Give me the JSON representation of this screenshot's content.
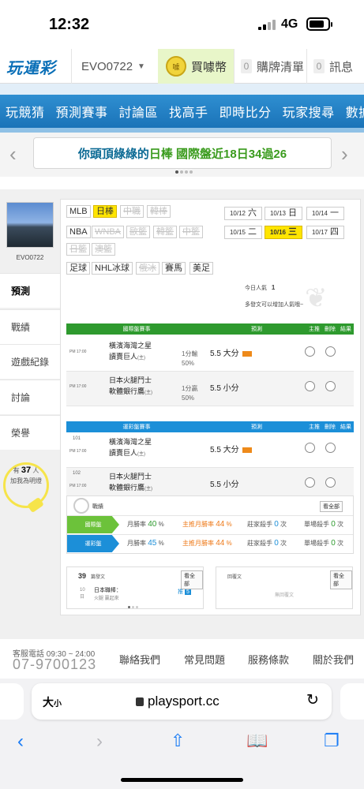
{
  "status_bar": {
    "time": "12:32",
    "network": "4G"
  },
  "nav": {
    "logo": "玩運彩",
    "username": "EVO0722",
    "buy_coin": "買噱幣",
    "coin_icon_text": "噱",
    "cart_count": "0",
    "cart_label": "購牌清單",
    "msg_count": "0",
    "msg_label": "訊息"
  },
  "main_menu": [
    "玩競猜",
    "預測賽事",
    "討論區",
    "找高手",
    "即時比分",
    "玩家搜尋",
    "數據"
  ],
  "marquee": {
    "prefix": "你頭頂綠綠的 ",
    "highlight": "日棒 國際盤近18日34過26"
  },
  "profile": {
    "name": "EVO0722"
  },
  "side_tabs": [
    "預測",
    "戰績",
    "遊戲紀錄",
    "討論",
    "榮譽"
  ],
  "recommend": {
    "prefix": "有",
    "count": "37",
    "unit": "人",
    "line2": "加我為明燈"
  },
  "leagues": [
    {
      "label": "MLB",
      "state": "normal"
    },
    {
      "label": "日棒",
      "state": "selected"
    },
    {
      "label": "中職",
      "state": "disabled"
    },
    {
      "label": "韓棒",
      "state": "disabled"
    },
    {
      "label": "NBA",
      "state": "normal"
    },
    {
      "label": "WNBA",
      "state": "disabled"
    },
    {
      "label": "歐籃",
      "state": "disabled"
    },
    {
      "label": "韓籃",
      "state": "disabled"
    },
    {
      "label": "中籃",
      "state": "disabled"
    },
    {
      "label": "日籃",
      "state": "disabled"
    },
    {
      "label": "澳籃",
      "state": "disabled"
    },
    {
      "label": "足球",
      "state": "normal"
    },
    {
      "label": "NHL冰球",
      "state": "normal"
    },
    {
      "label": "俄冰",
      "state": "disabled"
    },
    {
      "label": "賽馬",
      "state": "normal"
    },
    {
      "label": "美足",
      "state": "normal"
    }
  ],
  "dates": [
    {
      "md": "10/12",
      "wd": "六",
      "state": "normal"
    },
    {
      "md": "10/13",
      "wd": "日",
      "state": "normal"
    },
    {
      "md": "10/14",
      "wd": "一",
      "state": "normal"
    },
    {
      "md": "10/15",
      "wd": "二",
      "state": "normal"
    },
    {
      "md": "10/16",
      "wd": "三",
      "state": "selected"
    },
    {
      "md": "10/17",
      "wd": "四",
      "state": "normal"
    }
  ],
  "popularity": {
    "label": "今日人氣",
    "value": "1"
  },
  "tip": "多發文可以增加人氣哦~",
  "intl": {
    "headers": [
      "國際盤賽事",
      "預測",
      "主推",
      "刪除",
      "結果"
    ],
    "games": [
      {
        "time": "PM 17:00",
        "team1": "橫濱海灣之星",
        "team2": "讀賣巨人",
        "home_tag": "(主)",
        "line": "1分輸",
        "pct": "50%",
        "pick": "5.5 大分",
        "badge": true
      },
      {
        "time": "PM 17:00",
        "team1": "日本火腿鬥士",
        "team2": "軟體銀行鷹",
        "home_tag": "(主)",
        "line": "1分贏",
        "pct": "50%",
        "pick": "5.5 小分",
        "badge": false
      }
    ]
  },
  "lottery": {
    "headers": [
      "運彩盤賽事",
      "預測",
      "主推",
      "刪除",
      "結果"
    ],
    "games": [
      {
        "no": "101",
        "time": "PM 17:00",
        "team1": "橫濱海灣之星",
        "team2": "讀賣巨人",
        "home_tag": "(主)",
        "pick": "5.5 大分",
        "badge": true
      },
      {
        "no": "102",
        "time": "PM 17:00",
        "team1": "日本火腿鬥士",
        "team2": "軟體銀行鷹",
        "home_tag": "(主)",
        "pick": "5.5 小分",
        "badge": false
      }
    ]
  },
  "stats": {
    "title": "戰績",
    "see_all": "看全部",
    "rows": [
      {
        "label": "國際盤",
        "win_label": "月勝率",
        "win": "40",
        "main_label": "主推月勝率",
        "main": "44",
        "streak_label": "莊家殺手",
        "streak": "0",
        "unit": "次",
        "single_label": "單場殺手",
        "single": "0"
      },
      {
        "label": "運彩盤",
        "win_label": "月勝率",
        "win": "45",
        "main_label": "主推月勝率",
        "main": "44",
        "streak_label": "莊家殺手",
        "streak": "0",
        "unit": "次",
        "single_label": "單場殺手",
        "single": "0"
      }
    ]
  },
  "posts": {
    "count": "39",
    "label": "篇發文",
    "see_all": "看全部",
    "article_title": "日本職棒：",
    "article_sub": "火腿 贏起來",
    "day": "10",
    "day_sub": "日",
    "push_label": "推",
    "push_count": "5"
  },
  "replies": {
    "label": "回覆文",
    "see_all": "看全部",
    "empty": "無回覆文"
  },
  "footer": {
    "service": "客服電話 09:30 ~ 24:00",
    "phone": "07-9700123",
    "links": [
      "聯絡我們",
      "常見問題",
      "服務條款",
      "關於我們"
    ]
  },
  "safari": {
    "text_size": "大",
    "text_size_small": "小",
    "url": "playsport.cc"
  }
}
